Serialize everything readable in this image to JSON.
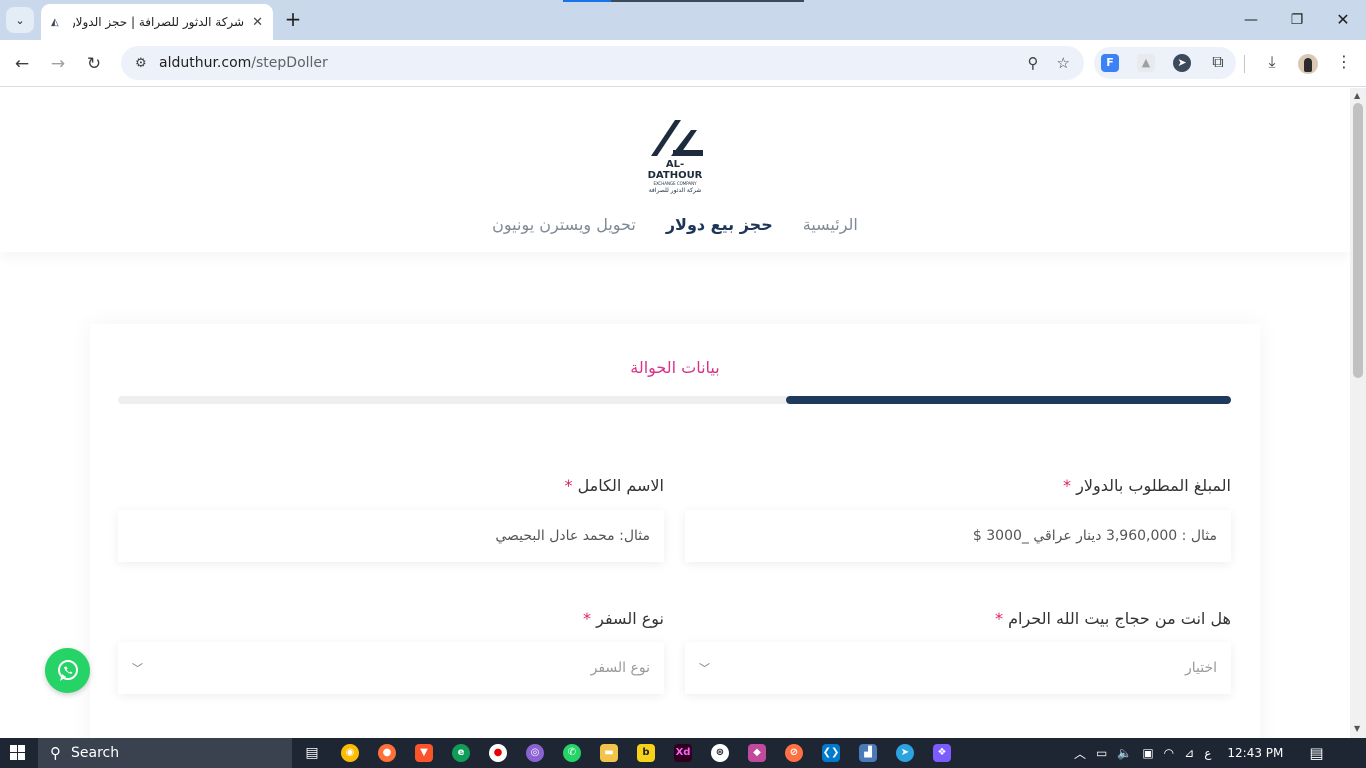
{
  "browser": {
    "tab_title": "شركة الدثور للصرافة | حجز الدولار",
    "url_host": "alduthur.com",
    "url_path": "/stepDoller"
  },
  "site": {
    "logo_name": "AL-DATHOUR",
    "logo_sub": "EXCHANGE COMPANY",
    "logo_ar": "شركة الدثور للصرافة",
    "nav": [
      {
        "label": "الرئيسية",
        "active": false
      },
      {
        "label": "حجز بيع دولار",
        "active": true
      },
      {
        "label": "تحويل ويسترن يونيون",
        "active": false
      }
    ]
  },
  "form": {
    "step_title": "بيانات الحوالة",
    "progress": 0.4,
    "amount_label": "المبلغ المطلوب بالدولار",
    "amount_placeholder": "مثال : 3,960,000 دينار عراقي _3000 $",
    "name_label": "الاسم الكامل",
    "name_placeholder": "مثال: محمد عادل البحيصي",
    "pilgrim_label": "هل انت من حجاج بيت الله الحرام",
    "pilgrim_value": "اختيار",
    "travel_label": "نوع السفر",
    "travel_value": "نوع السفر",
    "required_mark": "*"
  },
  "taskbar": {
    "search_label": "Search",
    "lang": "ع",
    "time": "12:43 PM"
  },
  "colors": {
    "accent": "#d6338a",
    "progress": "#1f3a5c",
    "whatsapp": "#25d366"
  }
}
